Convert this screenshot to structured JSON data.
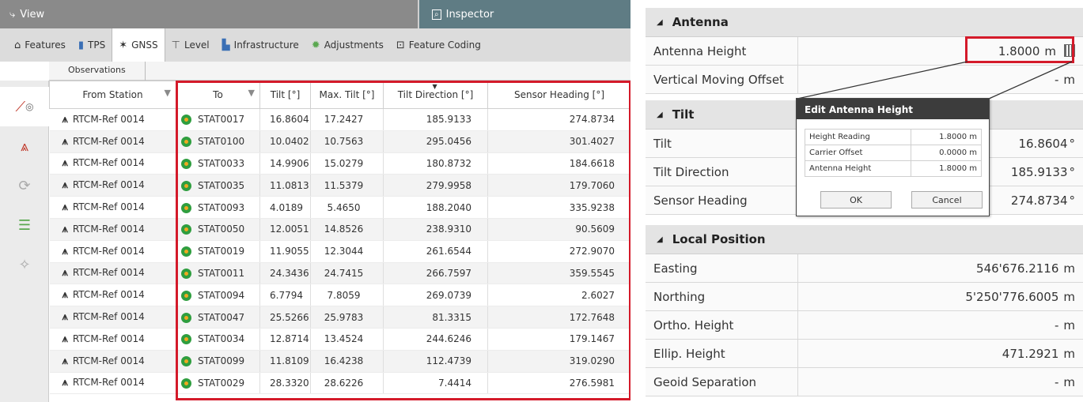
{
  "left": {
    "title": "View",
    "inspector_title": "Inspector",
    "tabs": [
      {
        "label": "Features",
        "icon": "house-icon",
        "active": false
      },
      {
        "label": "TPS",
        "icon": "tps-icon",
        "active": false
      },
      {
        "label": "GNSS",
        "icon": "satellite-icon",
        "active": true
      },
      {
        "label": "Level",
        "icon": "level-icon",
        "active": false
      },
      {
        "label": "Infrastructure",
        "icon": "infrastructure-icon",
        "active": false
      },
      {
        "label": "Adjustments",
        "icon": "gear-icon",
        "active": false
      },
      {
        "label": "Feature Coding",
        "icon": "coding-icon",
        "active": false
      }
    ],
    "breadcrumb": "Observations",
    "columns": [
      "From Station",
      "To",
      "Tilt [°]",
      "Max. Tilt [°]",
      "Tilt Direction [°]",
      "Sensor Heading [°]"
    ],
    "rows": [
      [
        "RTCM-Ref 0014",
        "STAT0017",
        "16.8604",
        "17.2427",
        "185.9133",
        "274.8734"
      ],
      [
        "RTCM-Ref 0014",
        "STAT0100",
        "10.0402",
        "10.7563",
        "295.0456",
        "301.4027"
      ],
      [
        "RTCM-Ref 0014",
        "STAT0033",
        "14.9906",
        "15.0279",
        "180.8732",
        "184.6618"
      ],
      [
        "RTCM-Ref 0014",
        "STAT0035",
        "11.0813",
        "11.5379",
        "279.9958",
        "179.7060"
      ],
      [
        "RTCM-Ref 0014",
        "STAT0093",
        "4.0189",
        "5.4650",
        "188.2040",
        "335.9238"
      ],
      [
        "RTCM-Ref 0014",
        "STAT0050",
        "12.0051",
        "14.8526",
        "238.9310",
        "90.5609"
      ],
      [
        "RTCM-Ref 0014",
        "STAT0019",
        "11.9055",
        "12.3044",
        "261.6544",
        "272.9070"
      ],
      [
        "RTCM-Ref 0014",
        "STAT0011",
        "24.3436",
        "24.7415",
        "266.7597",
        "359.5545"
      ],
      [
        "RTCM-Ref 0014",
        "STAT0094",
        "6.7794",
        "7.8059",
        "269.0739",
        "2.6027"
      ],
      [
        "RTCM-Ref 0014",
        "STAT0047",
        "25.5266",
        "25.9783",
        "81.3315",
        "172.7648"
      ],
      [
        "RTCM-Ref 0014",
        "STAT0034",
        "12.8714",
        "13.4524",
        "244.6246",
        "179.1467"
      ],
      [
        "RTCM-Ref 0014",
        "STAT0099",
        "11.8109",
        "16.4238",
        "112.4739",
        "319.0290"
      ],
      [
        "RTCM-Ref 0014",
        "STAT0029",
        "28.3320",
        "28.6226",
        "7.4414",
        "276.5981"
      ]
    ]
  },
  "inspector": {
    "sections": {
      "antenna": "Antenna",
      "tilt": "Tilt",
      "local_position": "Local Position"
    },
    "antenna_height": {
      "label": "Antenna Height",
      "value": "1.8000",
      "unit": "m"
    },
    "vertical_offset": {
      "label": "Vertical Moving Offset",
      "value": "-",
      "unit": "m"
    },
    "tilt": {
      "label": "Tilt",
      "value": "16.8604",
      "unit": "°"
    },
    "tilt_direction": {
      "label": "Tilt Direction",
      "value": "185.9133",
      "unit": "°"
    },
    "sensor_heading": {
      "label": "Sensor Heading",
      "value": "274.8734",
      "unit": "°"
    },
    "easting": {
      "label": "Easting",
      "value": "546'676.2116",
      "unit": "m"
    },
    "northing": {
      "label": "Northing",
      "value": "5'250'776.6005",
      "unit": "m"
    },
    "ortho_height": {
      "label": "Ortho. Height",
      "value": "-",
      "unit": "m"
    },
    "ellip_height": {
      "label": "Ellip. Height",
      "value": "471.2921",
      "unit": "m"
    },
    "geoid_separation": {
      "label": "Geoid Separation",
      "value": "-",
      "unit": "m"
    }
  },
  "dialog": {
    "title": "Edit Antenna Height",
    "rows": [
      {
        "label": "Height Reading",
        "value": "1.8000",
        "unit": "m"
      },
      {
        "label": "Carrier Offset",
        "value": "0.0000",
        "unit": "m"
      },
      {
        "label": "Antenna Height",
        "value": "1.8000",
        "unit": "m"
      }
    ],
    "ok": "OK",
    "cancel": "Cancel"
  },
  "colors": {
    "highlight": "#d41a2a",
    "inspector_bar": "#5f7c84",
    "view_bar": "#8a8a8a"
  }
}
